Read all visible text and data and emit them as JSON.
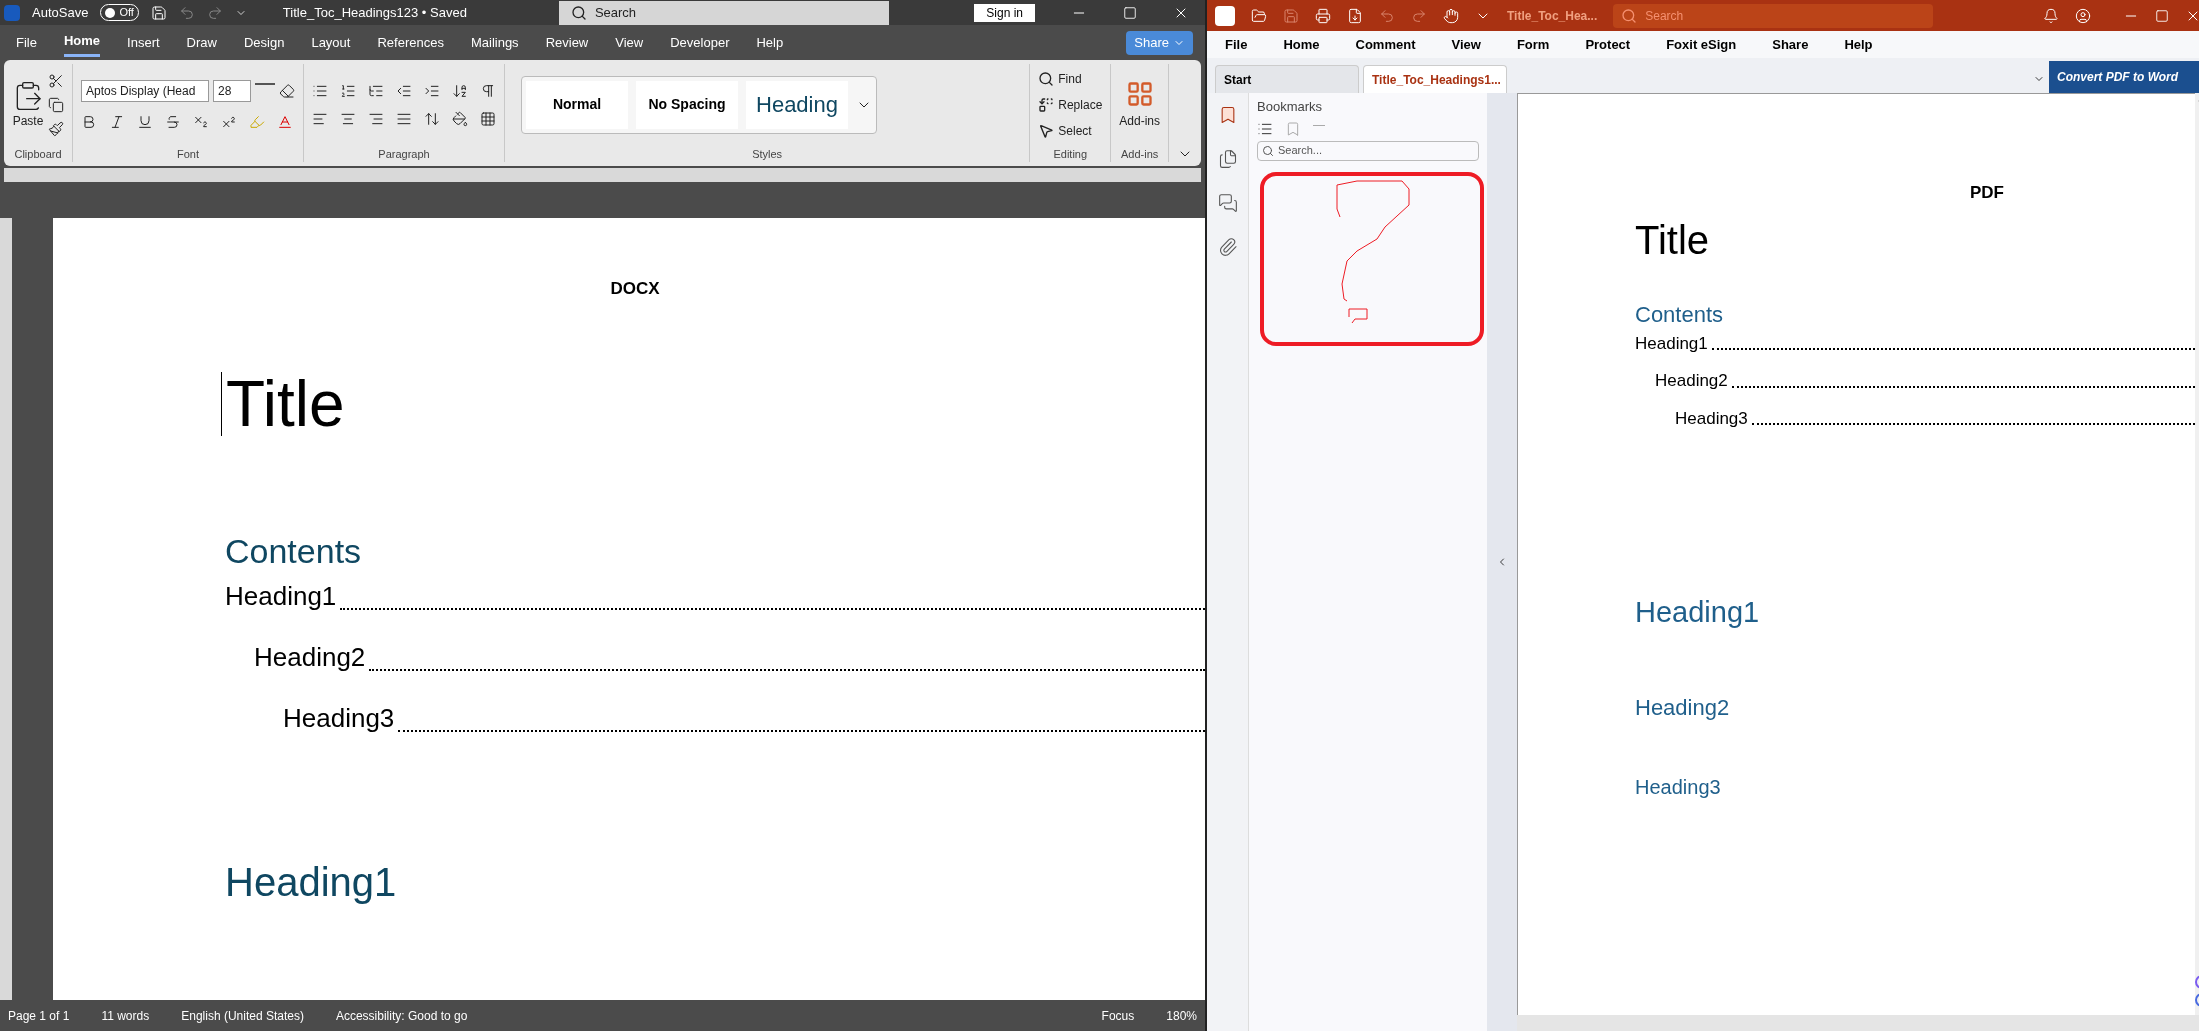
{
  "word": {
    "title_bar": {
      "autosave_label": "AutoSave",
      "autosave": {
        "on": false,
        "label": "Off"
      },
      "doc_title": "Title_Toc_Headings123 • Saved",
      "search_placeholder": "Search",
      "sign_in": "Sign in"
    },
    "menu": [
      {
        "label": "File",
        "selected": false
      },
      {
        "label": "Home",
        "selected": true
      },
      {
        "label": "Insert",
        "selected": false
      },
      {
        "label": "Draw",
        "selected": false
      },
      {
        "label": "Design",
        "selected": false
      },
      {
        "label": "Layout",
        "selected": false
      },
      {
        "label": "References",
        "selected": false
      },
      {
        "label": "Mailings",
        "selected": false
      },
      {
        "label": "Review",
        "selected": false
      },
      {
        "label": "View",
        "selected": false
      },
      {
        "label": "Developer",
        "selected": false
      },
      {
        "label": "Help",
        "selected": false
      }
    ],
    "share": "Share",
    "ribbon": {
      "paste": "Paste",
      "font_name": "Aptos Display (Head",
      "font_size": "28",
      "styles": [
        {
          "label": "Normal",
          "kind": "normal"
        },
        {
          "label": "No Spacing",
          "kind": "nospacing"
        },
        {
          "label": "Heading",
          "kind": "heading"
        }
      ],
      "find": "Find",
      "replace": "Replace",
      "select": "Select",
      "addins": "Add-ins",
      "groups": [
        "Clipboard",
        "Font",
        "Paragraph",
        "Styles",
        "Editing",
        "Add-ins"
      ]
    },
    "document": {
      "header": "DOCX",
      "title": "Title",
      "contents": "Contents",
      "toc": [
        {
          "label": "Heading1",
          "children": [
            {
              "label": "Heading2",
              "children": [
                {
                  "label": "Heading3"
                }
              ]
            }
          ]
        }
      ],
      "heading": "Heading1"
    },
    "status_bar": [
      "Page 1 of 1",
      "11 words",
      "English (United States)",
      "Accessibility: Good to go",
      "Focus",
      "180%"
    ]
  },
  "foxit": {
    "doc_title": "Title_Toc_Hea...",
    "search_placeholder": "Search",
    "menu": [
      "File",
      "Home",
      "Comment",
      "View",
      "Form",
      "Protect",
      "Foxit eSign",
      "Share",
      "Help"
    ],
    "tabs": [
      {
        "label": "Start",
        "selected": false
      },
      {
        "label": "Title_Toc_Headings1...",
        "selected": true
      }
    ],
    "convert": "Convert PDF to Word",
    "bookmarks": {
      "title": "Bookmarks",
      "search_placeholder": "Search..."
    },
    "rail": [
      {
        "kind": "bookmark",
        "selected": true
      },
      {
        "kind": "pages",
        "selected": false
      },
      {
        "kind": "comments",
        "selected": false
      },
      {
        "kind": "attachments",
        "selected": false
      }
    ],
    "page": {
      "header": "PDF",
      "title": "Title",
      "contents": "Contents",
      "toc": [
        {
          "label": "Heading1",
          "children": [
            {
              "label": "Heading2",
              "children": [
                {
                  "label": "Heading3"
                }
              ]
            }
          ]
        }
      ],
      "headings": [
        {
          "label": "Heading1",
          "kind": "h1"
        },
        {
          "label": "Heading2",
          "kind": "h2"
        },
        {
          "label": "Heading3",
          "kind": "h3"
        }
      ]
    }
  }
}
